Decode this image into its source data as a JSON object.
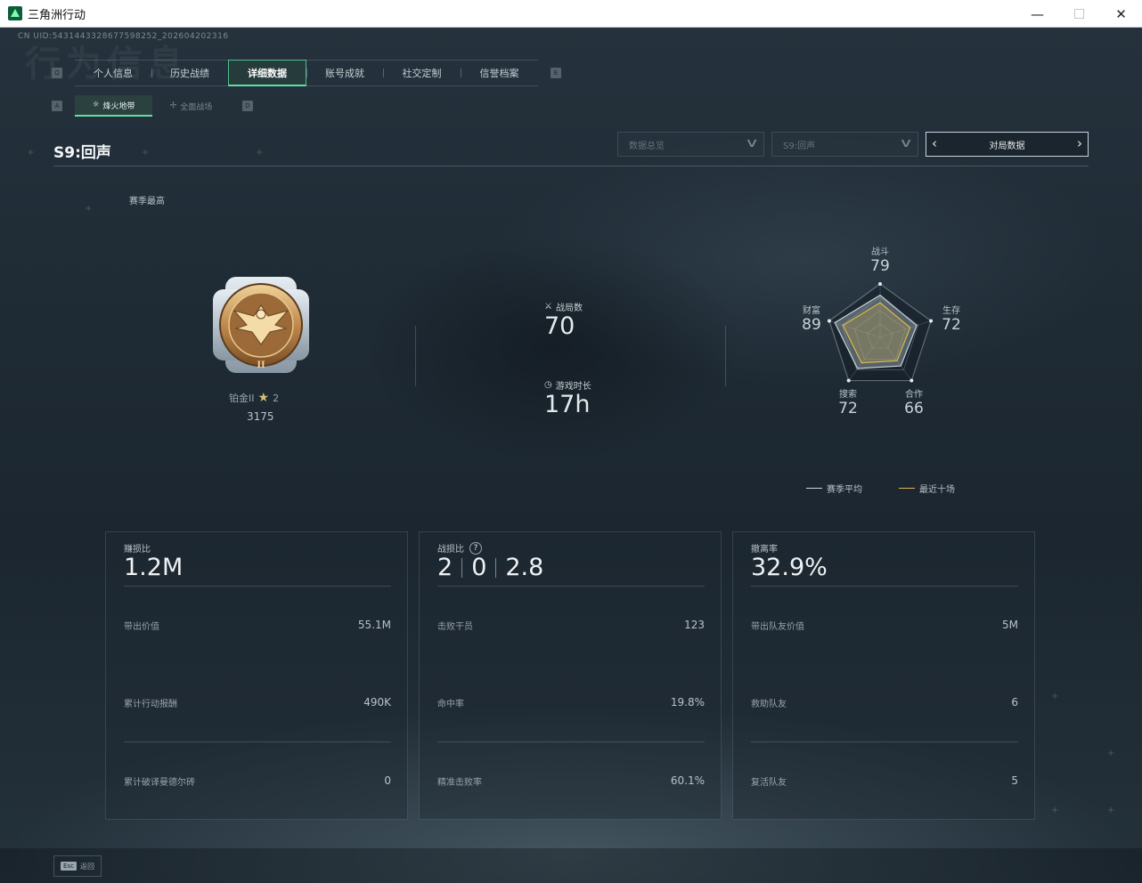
{
  "window": {
    "title": "三角洲行动",
    "minimize": "—",
    "maximize": "☐",
    "close": "✕"
  },
  "header": {
    "uid": "CN UID:5431443328677598252_202604202316",
    "watermark": "行为信息"
  },
  "main_tabs": {
    "left_key": "Q",
    "right_key": "E",
    "items": [
      {
        "label": "个人信息"
      },
      {
        "label": "历史战绩"
      },
      {
        "label": "详细数据"
      },
      {
        "label": "账号成就"
      },
      {
        "label": "社交定制"
      },
      {
        "label": "信誉档案"
      }
    ]
  },
  "sub_tabs": {
    "left_key": "A",
    "right_key": "D",
    "items": [
      {
        "label": "烽火地带"
      },
      {
        "label": "全面战场"
      }
    ]
  },
  "season": {
    "title": "S9:回声",
    "dropdown1": "数据总览",
    "dropdown2": "S9:回声",
    "pager_label": "对局数据",
    "best_label": "赛季最高"
  },
  "rank": {
    "name": "铂金II",
    "stars": "2",
    "score": "3175",
    "roman": "II"
  },
  "overview": {
    "matches_label": "战局数",
    "matches_value": "70",
    "playtime_label": "游戏时长",
    "playtime_value": "17h"
  },
  "radar": {
    "axes": [
      {
        "name": "战斗",
        "value": "79"
      },
      {
        "name": "生存",
        "value": "72"
      },
      {
        "name": "合作",
        "value": "66"
      },
      {
        "name": "搜索",
        "value": "72"
      },
      {
        "name": "财富",
        "value": "89"
      }
    ],
    "legend": {
      "season_avg": "赛季平均",
      "recent_ten": "最近十场"
    },
    "colors": {
      "season_avg": "#c9d3d8",
      "recent_ten": "#d9b84a"
    }
  },
  "cards": [
    {
      "title": "赚损比",
      "main": "1.2M",
      "rows": [
        {
          "label": "带出价值",
          "value": "55.1M"
        },
        {
          "label": "累计行动报酬",
          "value": "490K"
        },
        {
          "label": "累计破译曼德尔砖",
          "value": "0"
        }
      ]
    },
    {
      "title": "战损比",
      "help": "?",
      "main_parts": [
        "2",
        "0",
        "2.8"
      ],
      "rows": [
        {
          "label": "击败干员",
          "value": "123"
        },
        {
          "label": "命中率",
          "value": "19.8%"
        },
        {
          "label": "精准击败率",
          "value": "60.1%"
        }
      ]
    },
    {
      "title": "撤离率",
      "main": "32.9%",
      "rows": [
        {
          "label": "带出队友价值",
          "value": "5M"
        },
        {
          "label": "救助队友",
          "value": "6"
        },
        {
          "label": "复活队友",
          "value": "5"
        }
      ]
    }
  ],
  "footer": {
    "esc_key": "Esc",
    "esc_label": "返回"
  }
}
